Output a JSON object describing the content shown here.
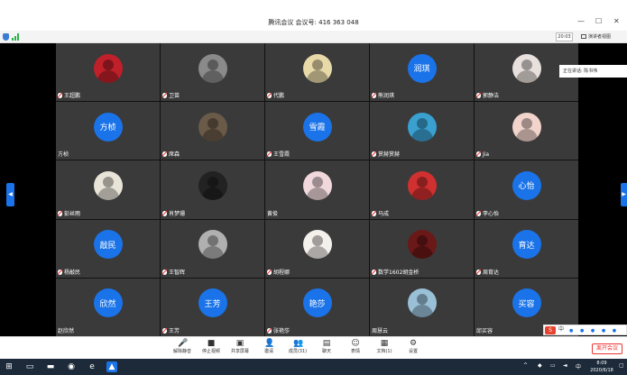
{
  "window": {
    "title": "腾讯会议  会议号: 416 363 048",
    "minimize": "—",
    "maximize": "☐",
    "close": "✕"
  },
  "infobar": {
    "timer": "20:03",
    "speaker_view": "演讲者视图"
  },
  "speaking": "正在讲话: 陈书伟",
  "participants": [
    {
      "name": "王超鹏",
      "avatar": "photo",
      "color": "#c0202a",
      "muted": true
    },
    {
      "name": "卫苗",
      "avatar": "photo",
      "color": "#8a8a8a",
      "muted": true
    },
    {
      "name": "代鹏",
      "avatar": "photo",
      "color": "#e8d9a8",
      "muted": true
    },
    {
      "name": "熊润琪",
      "avatar": "text",
      "text": "润琪",
      "muted": true
    },
    {
      "name": "郭静洁",
      "avatar": "photo",
      "color": "#e8e0dc",
      "muted": true
    },
    {
      "name": "方桢",
      "avatar": "text",
      "text": "方桢",
      "muted": false
    },
    {
      "name": "席森",
      "avatar": "photo",
      "color": "#6a5a48",
      "muted": true
    },
    {
      "name": "王雪霞",
      "avatar": "text",
      "text": "雪霞",
      "muted": true
    },
    {
      "name": "赏赫赏赫",
      "avatar": "photo",
      "color": "#3aa0d0",
      "muted": true
    },
    {
      "name": "Jia",
      "avatar": "photo",
      "color": "#f2d4cc",
      "muted": true
    },
    {
      "name": "彭丝雨",
      "avatar": "photo",
      "color": "#e8e4d8",
      "muted": true
    },
    {
      "name": "肖梦珊",
      "avatar": "photo",
      "color": "#222222",
      "muted": true
    },
    {
      "name": "黄俊",
      "avatar": "photo",
      "color": "#f0d8dc",
      "muted": false
    },
    {
      "name": "马成",
      "avatar": "photo",
      "color": "#d03030",
      "muted": true
    },
    {
      "name": "李心怡",
      "avatar": "text",
      "text": "心怡",
      "muted": true
    },
    {
      "name": "杨敲民",
      "avatar": "text",
      "text": "敲民",
      "muted": true
    },
    {
      "name": "王智辉",
      "avatar": "photo",
      "color": "#b0b0b0",
      "muted": true
    },
    {
      "name": "胡程娜",
      "avatar": "photo",
      "color": "#f4f0ec",
      "muted": true
    },
    {
      "name": "数学1602胡金桥",
      "avatar": "photo",
      "color": "#6a1818",
      "muted": true
    },
    {
      "name": "周育达",
      "avatar": "text",
      "text": "育达",
      "muted": true
    },
    {
      "name": "赵欣然",
      "avatar": "text",
      "text": "欣然",
      "muted": false
    },
    {
      "name": "王芳",
      "avatar": "text",
      "text": "王芳",
      "muted": true
    },
    {
      "name": "张艳莎",
      "avatar": "text",
      "text": "艳莎",
      "muted": true
    },
    {
      "name": "周慧云",
      "avatar": "photo",
      "color": "#9ac0d8",
      "muted": false
    },
    {
      "name": "邱买容",
      "avatar": "text",
      "text": "买容",
      "muted": false
    }
  ],
  "toolbar": {
    "buttons": [
      {
        "label": "解除静音",
        "icon": "🎤"
      },
      {
        "label": "停止视频",
        "icon": "■"
      },
      {
        "label": "共享屏幕",
        "icon": "▣"
      },
      {
        "label": "邀请",
        "icon": "👤"
      },
      {
        "label": "成员(31)",
        "icon": "👥"
      },
      {
        "label": "聊天",
        "icon": "▤"
      },
      {
        "label": "表情",
        "icon": "☺"
      },
      {
        "label": "文档(1)",
        "icon": "▦"
      },
      {
        "label": "设置",
        "icon": "⚙"
      }
    ],
    "leave": "离开会议"
  },
  "ime": {
    "logo": "S",
    "mode": "中"
  },
  "taskbar": {
    "clock_time": "8:09",
    "clock_date": "2020/6/18"
  }
}
